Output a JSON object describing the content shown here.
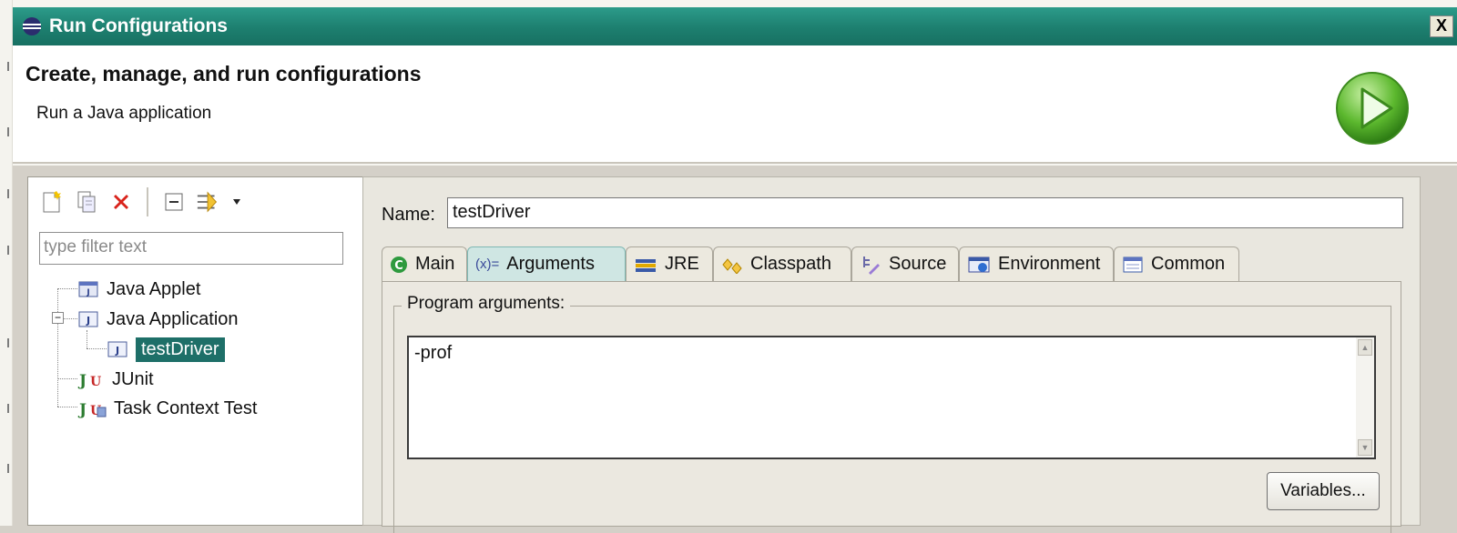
{
  "window": {
    "title": "Run Configurations",
    "close_glyph": "X"
  },
  "header": {
    "title": "Create, manage, and run configurations",
    "subtitle": "Run a Java application"
  },
  "left": {
    "toolbar": [
      "new-config-icon",
      "duplicate-icon",
      "delete-icon",
      "collapse-all-icon",
      "filter-icon",
      "view-menu-icon"
    ],
    "filter_placeholder": "type filter text",
    "tree": [
      {
        "label": "Java Applet",
        "icon": "java-applet-icon"
      },
      {
        "label": "Java Application",
        "icon": "java-application-icon",
        "expanded": true
      },
      {
        "label": "testDriver",
        "icon": "java-application-icon",
        "selected": true
      },
      {
        "label": "JUnit",
        "icon": "junit-icon"
      },
      {
        "label": "Task Context Test",
        "icon": "task-context-icon"
      }
    ]
  },
  "right": {
    "name_label": "Name:",
    "name_value": "testDriver",
    "tabs": [
      {
        "label": "Main",
        "icon": "main-tab-icon"
      },
      {
        "label": "Arguments",
        "prefix": "(x)=",
        "active": true
      },
      {
        "label": "JRE",
        "icon": "jre-icon"
      },
      {
        "label": "Classpath",
        "icon": "classpath-icon"
      },
      {
        "label": "Source",
        "icon": "source-icon"
      },
      {
        "label": "Environment",
        "icon": "environment-icon"
      },
      {
        "label": "Common",
        "icon": "common-icon"
      }
    ],
    "program_args_label": "Program arguments:",
    "program_args_value": "-prof",
    "variables_button": "Variables..."
  },
  "colors": {
    "titlebar": "#1d7f6f",
    "selection": "#1e6f68",
    "active_tab": "#cfe6e3"
  }
}
